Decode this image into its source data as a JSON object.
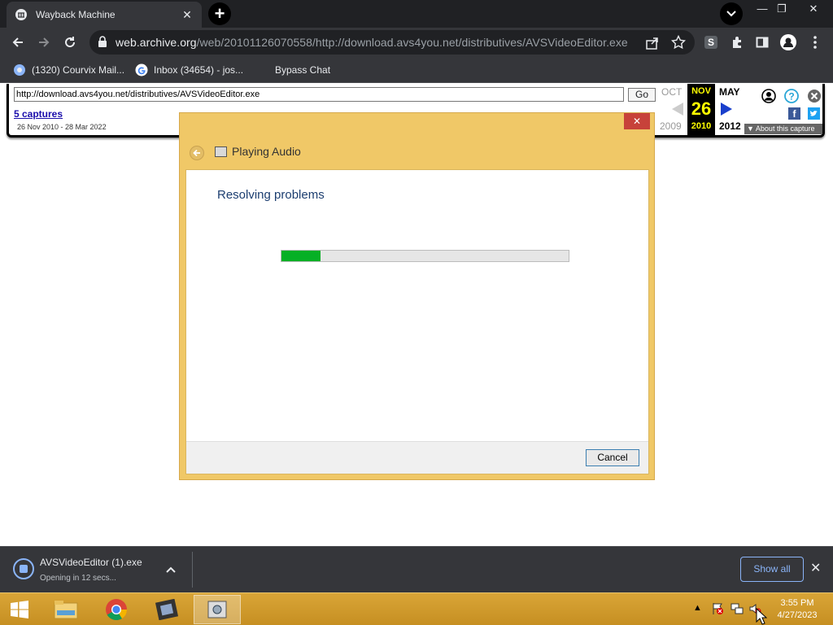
{
  "browser": {
    "tab_title": "Wayback Machine",
    "url_host": "web.archive.org",
    "url_path": "/web/20101126070558/http://download.avs4you.net/distributives/AVSVideoEditor.exe",
    "bookmarks": [
      {
        "label": "(1320) Courvix Mail...",
        "icon": "courvix-icon"
      },
      {
        "label": "Inbox (34654) - jos...",
        "icon": "google-icon"
      },
      {
        "label": "Bypass Chat",
        "icon": "blank-icon"
      }
    ]
  },
  "wayback": {
    "url_value": "http://download.avs4you.net/distributives/AVSVideoEditor.exe",
    "go_label": "Go",
    "captures_label": "5 captures",
    "date_range": "26 Nov 2010 - 28 Mar 2022",
    "prev_month": "OCT",
    "prev_year": "2009",
    "current_month": "NOV",
    "current_day": "26",
    "current_year": "2010",
    "next_month": "MAY",
    "next_year": "2012",
    "about_label": "About this capture"
  },
  "dialog": {
    "title": "Playing Audio",
    "close_label": "✕",
    "heading": "Resolving problems",
    "progress": 0.135,
    "cancel_label": "Cancel"
  },
  "download": {
    "filename": "AVSVideoEditor (1).exe",
    "status": "Opening in 12 secs...",
    "show_all_label": "Show all"
  },
  "taskbar": {
    "time": "3:55 PM",
    "date": "4/27/2023"
  },
  "colors": {
    "dialog_frame": "#f0c867",
    "progress_fill": "#06b025",
    "chrome_dark": "#35363a",
    "taskbar": "#d9a537"
  }
}
